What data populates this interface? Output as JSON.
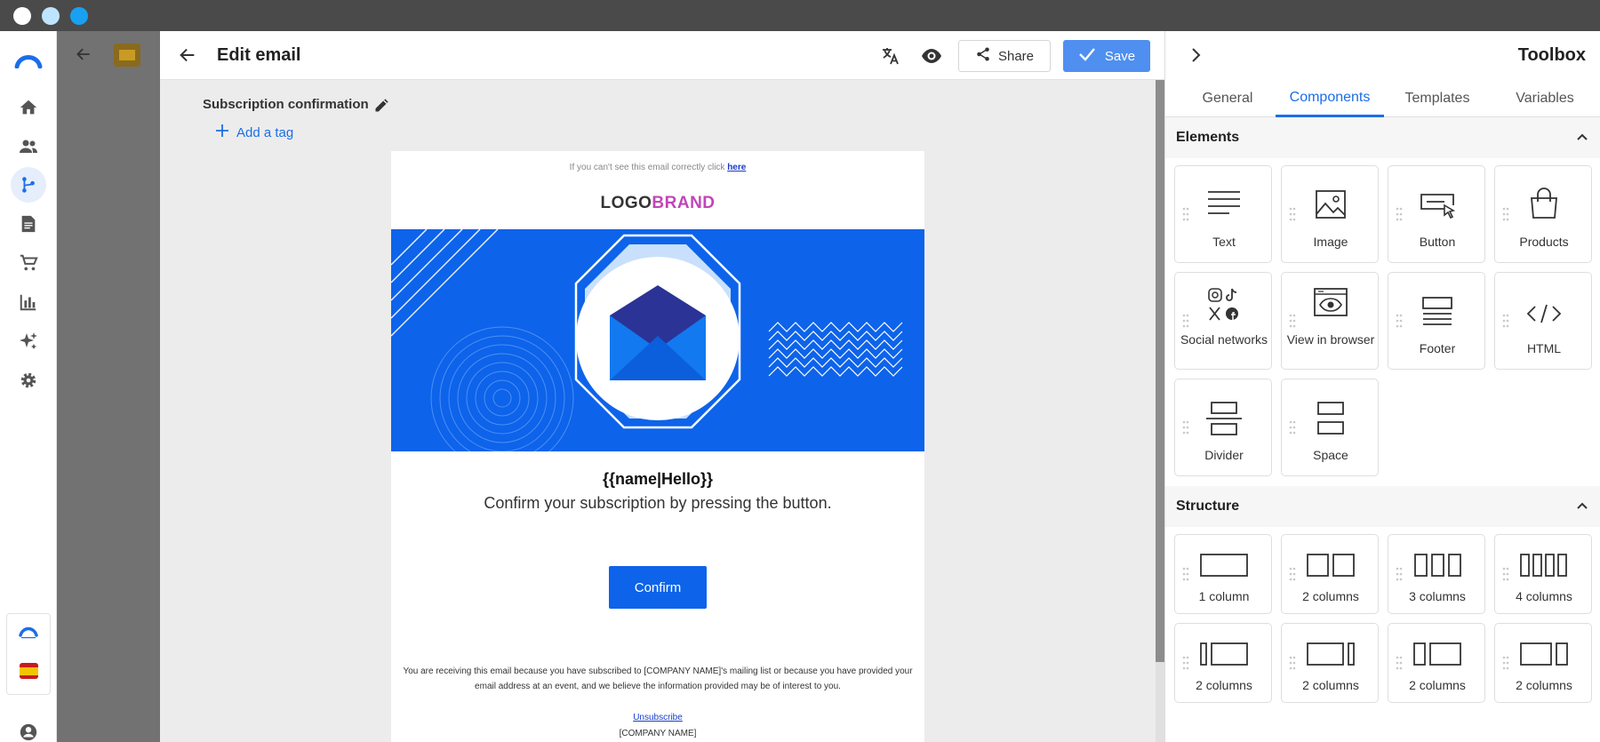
{
  "window": {
    "dot_colors": [
      "#ffffff",
      "#bfe4ff",
      "#1aa0f0"
    ]
  },
  "rail": {
    "items": [
      {
        "name": "home-icon"
      },
      {
        "name": "contacts-icon"
      },
      {
        "name": "automation-icon",
        "active": true
      },
      {
        "name": "document-icon"
      },
      {
        "name": "cart-icon"
      },
      {
        "name": "reports-icon"
      },
      {
        "name": "ai-sparkle-icon"
      },
      {
        "name": "settings-icon"
      }
    ]
  },
  "editor": {
    "title": "Edit email",
    "share_label": "Share",
    "save_label": "Save",
    "subject": "Subscription confirmation",
    "add_tag_label": "Add a tag"
  },
  "email": {
    "preheader": "If you can't see this email correctly click",
    "preheader_link": "here",
    "logo_part1": "LOGO",
    "logo_part2": "BRAND",
    "greeting": "{{name|Hello}}",
    "subtitle": "Confirm your subscription by pressing the button.",
    "button_label": "Confirm",
    "footer_text": "You are receiving this email because you have subscribed to [COMPANY NAME]'s mailing list or because you have provided your email address at an event, and we believe the information provided may be of interest to you.",
    "unsubscribe": "Unsubscribe",
    "company": "[COMPANY NAME]",
    "colors": {
      "brand_blue": "#0d63ea",
      "logo_brand": "#c146b8"
    }
  },
  "toolbox": {
    "title": "Toolbox",
    "tabs": [
      "General",
      "Components",
      "Templates",
      "Variables"
    ],
    "active_tab": "Components",
    "elements_title": "Elements",
    "elements": [
      {
        "label": "Text",
        "icon": "text-icon"
      },
      {
        "label": "Image",
        "icon": "image-icon"
      },
      {
        "label": "Button",
        "icon": "button-icon"
      },
      {
        "label": "Products",
        "icon": "shopping-bag-icon"
      },
      {
        "label": "Social networks",
        "icon": "social-networks-icon"
      },
      {
        "label": "View in browser",
        "icon": "view-in-browser-icon"
      },
      {
        "label": "Footer",
        "icon": "footer-icon"
      },
      {
        "label": "HTML",
        "icon": "code-icon"
      },
      {
        "label": "Divider",
        "icon": "divider-icon"
      },
      {
        "label": "Space",
        "icon": "space-icon"
      }
    ],
    "structure_title": "Structure",
    "structures": [
      {
        "label": "1 column"
      },
      {
        "label": "2 columns"
      },
      {
        "label": "3 columns"
      },
      {
        "label": "4 columns"
      },
      {
        "label": "2 columns"
      },
      {
        "label": "2 columns"
      },
      {
        "label": "2 columns"
      },
      {
        "label": "2 columns"
      }
    ]
  }
}
